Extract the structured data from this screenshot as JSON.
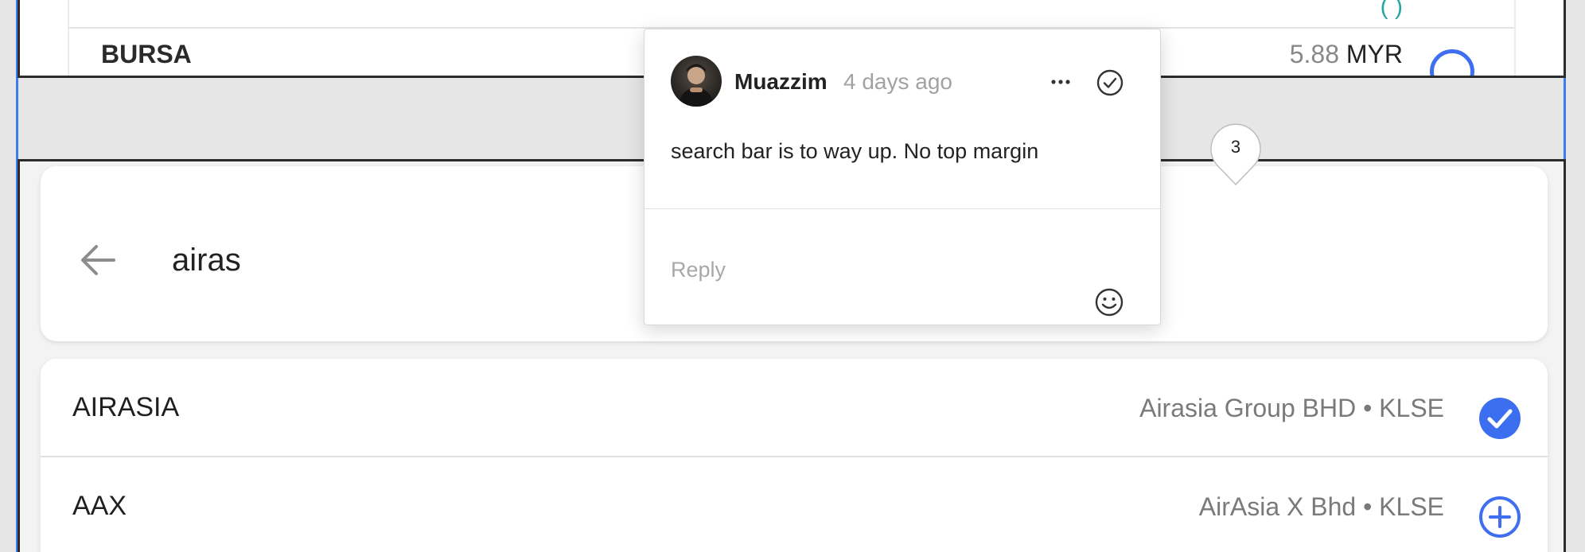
{
  "colors": {
    "accent": "#3f6ff0",
    "check_fill": "#3c6ff0",
    "teal_text": "#27a7a3",
    "muted_text": "#7a7a7a"
  },
  "top_list": {
    "partial_text": "(      )",
    "row": {
      "ticker": "BURSA",
      "price": "5.88",
      "currency": "MYR",
      "action_icon": "plus-circle-icon"
    }
  },
  "search": {
    "back_icon": "arrow-left-icon",
    "query": "airas"
  },
  "results": [
    {
      "ticker": "AIRASIA",
      "description": "Airasia Group BHD • KLSE",
      "state": "added",
      "icon": "check-circle-icon"
    },
    {
      "ticker": "AAX",
      "description": "AirAsia X Bhd • KLSE",
      "state": "not-added",
      "icon": "plus-circle-icon"
    }
  ],
  "comment": {
    "author": "Muazzim",
    "time": "4 days ago",
    "text": "search bar is to way up. No top margin",
    "reply_placeholder": "Reply",
    "more_icon": "ellipsis-icon",
    "resolve_icon": "check-circle-outline-icon",
    "emoji_icon": "smiley-icon"
  },
  "pin": {
    "number": "3"
  }
}
